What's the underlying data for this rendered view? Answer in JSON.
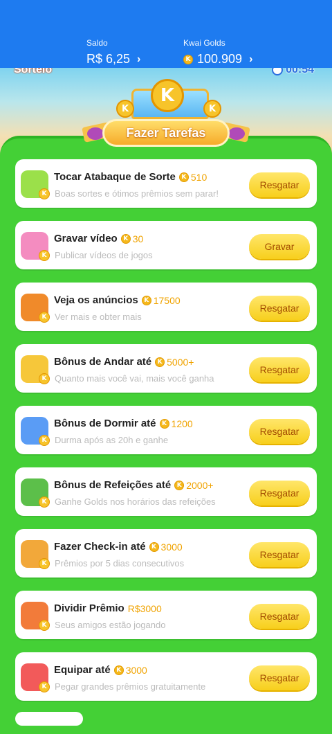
{
  "balance": {
    "saldo_label": "Saldo",
    "saldo_value": "R$ 6,25",
    "golds_label": "Kwai Golds",
    "golds_value": "100.909",
    "chevron": "›"
  },
  "header": {
    "sorteio": "Sorteio",
    "timer": "00:54",
    "banner_title": "Fazer Tarefas",
    "coin_letter": "K"
  },
  "tasks": [
    {
      "title": "Tocar Atabaque de Sorte",
      "reward": "510",
      "reward_type": "coin",
      "subtitle": "Boas sortes e ótimos prêmios sem parar!",
      "button": "Resgatar",
      "icon": "drum-frog-icon",
      "icon_color": "#9be04a"
    },
    {
      "title": "Gravar vídeo",
      "reward": "30",
      "reward_type": "coin",
      "subtitle": "Publicar vídeos de jogos",
      "button": "Gravar",
      "icon": "video-camera-icon",
      "icon_color": "#f48cc0"
    },
    {
      "title": "Veja os anúncios",
      "reward": "17500",
      "reward_type": "coin",
      "subtitle": "Ver mais e obter mais",
      "button": "Resgatar",
      "icon": "tv-icon",
      "icon_color": "#f08a2a"
    },
    {
      "title": "Bônus de Andar até",
      "reward": "5000+",
      "reward_type": "coin",
      "subtitle": "Quanto mais você vai, mais você ganha",
      "button": "Resgatar",
      "icon": "walking-boy-icon",
      "icon_color": "#f6c73a"
    },
    {
      "title": "Bônus de Dormir até",
      "reward": "1200",
      "reward_type": "coin",
      "subtitle": "Durma após as 20h e ganhe",
      "button": "Resgatar",
      "icon": "moon-icon",
      "icon_color": "#5a9cf5"
    },
    {
      "title": "Bônus de Refeições até",
      "reward": "2000+",
      "reward_type": "coin",
      "subtitle": "Ganhe Golds nos horários das refeições",
      "button": "Resgatar",
      "icon": "meal-box-icon",
      "icon_color": "#5cbf4a"
    },
    {
      "title": "Fazer Check-in até",
      "reward": "3000",
      "reward_type": "coin",
      "subtitle": "Prêmios por 5 dias consecutivos",
      "button": "Resgatar",
      "icon": "calendar-icon",
      "icon_color": "#f2a83a"
    },
    {
      "title": "Dividir Prêmio",
      "reward": "R$3000",
      "reward_type": "cash",
      "subtitle": "Seus amigos estão jogando",
      "button": "Resgatar",
      "icon": "gift-icon",
      "icon_color": "#f27b3a"
    },
    {
      "title": "Equipar até",
      "reward": "3000",
      "reward_type": "coin",
      "subtitle": "Pegar grandes prêmios gratuitamente",
      "button": "Resgatar",
      "icon": "boxing-gloves-icon",
      "icon_color": "#f25a5a"
    }
  ],
  "colors": {
    "topbar": "#1e7bf0",
    "board_green": "#44d036",
    "button_yellow": "#f7cf1c",
    "button_text": "#a24a00",
    "reward_gold": "#f0a300"
  }
}
